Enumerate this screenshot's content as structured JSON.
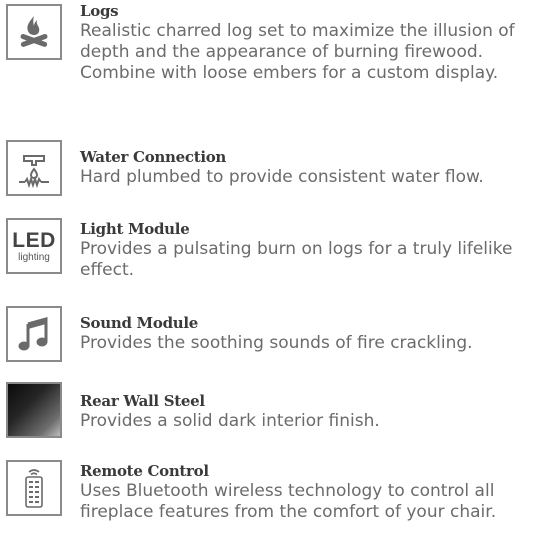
{
  "features": [
    {
      "icon": "campfire-icon",
      "title": "Logs",
      "description": "Realistic charred log set to maximize the illusion of depth and the appearance of burning firewood. Combine with loose embers for a custom display."
    },
    {
      "icon": "water-faucet-icon",
      "title": "Water Connection",
      "description": "Hard plumbed to provide consistent water flow."
    },
    {
      "icon": "led-lighting-icon",
      "icon_text": {
        "main": "LED",
        "sub": "lighting"
      },
      "title": "Light Module",
      "description": "Provides a pulsating burn on logs for a truly lifelike effect."
    },
    {
      "icon": "music-note-icon",
      "title": "Sound Module",
      "description": "Provides the soothing sounds of fire crackling."
    },
    {
      "icon": "dark-steel-swatch-icon",
      "title": "Rear Wall Steel",
      "description": "Provides a solid dark interior finish."
    },
    {
      "icon": "remote-control-icon",
      "title": "Remote Control",
      "description": "Uses Bluetooth wireless technology to control all fireplace features from the comfort of your chair."
    }
  ]
}
